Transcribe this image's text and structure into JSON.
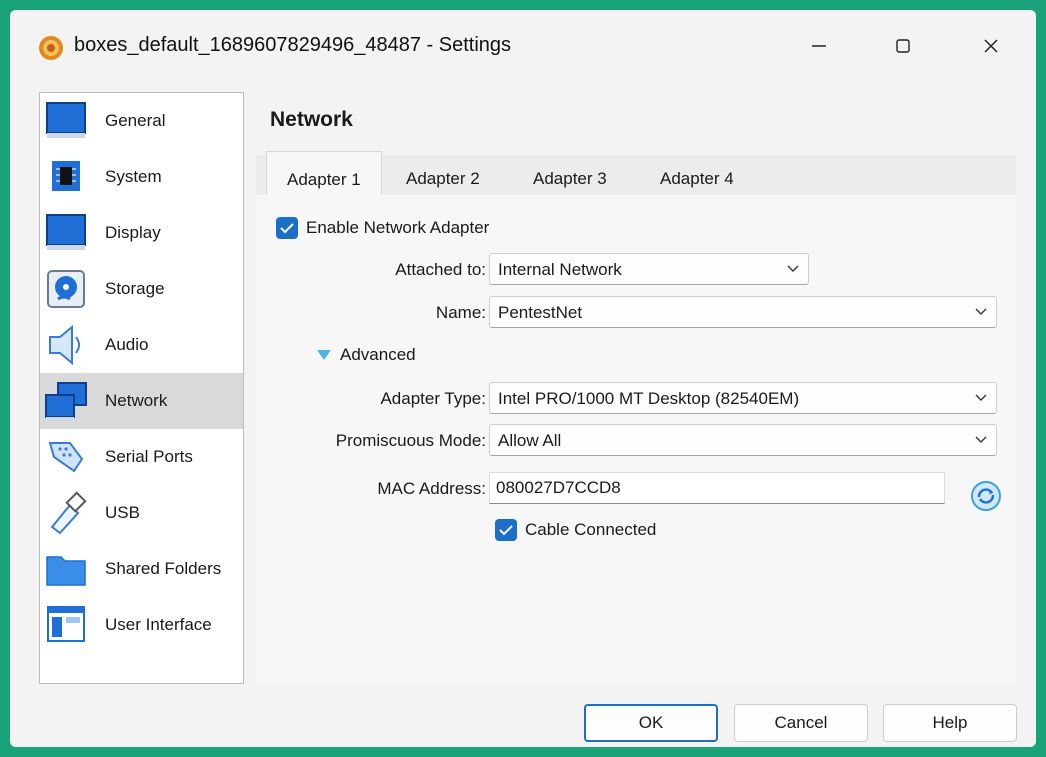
{
  "window": {
    "title": "boxes_default_1689607829496_48487 - Settings",
    "icons": {
      "app": "virtualbox-gear-icon",
      "minimize": "minimize-icon",
      "maximize": "maximize-icon",
      "close": "close-icon"
    }
  },
  "sidebar": {
    "items": [
      {
        "label": "General",
        "icon": "general-icon"
      },
      {
        "label": "System",
        "icon": "system-chip-icon"
      },
      {
        "label": "Display",
        "icon": "display-monitor-icon"
      },
      {
        "label": "Storage",
        "icon": "storage-disk-icon"
      },
      {
        "label": "Audio",
        "icon": "audio-speaker-icon"
      },
      {
        "label": "Network",
        "icon": "network-icon",
        "selected": true
      },
      {
        "label": "Serial Ports",
        "icon": "serial-port-icon"
      },
      {
        "label": "USB",
        "icon": "usb-icon"
      },
      {
        "label": "Shared Folders",
        "icon": "folder-icon"
      },
      {
        "label": "User Interface",
        "icon": "user-interface-icon"
      }
    ]
  },
  "panel": {
    "title": "Network",
    "tabs": [
      {
        "label": "Adapter 1",
        "active": true
      },
      {
        "label": "Adapter 2"
      },
      {
        "label": "Adapter 3"
      },
      {
        "label": "Adapter 4"
      }
    ],
    "enable_adapter": {
      "label": "Enable Network Adapter",
      "checked": true
    },
    "attached_to": {
      "label": "Attached to:",
      "value": "Internal Network"
    },
    "name": {
      "label": "Name:",
      "value": "PentestNet"
    },
    "advanced": {
      "label": "Advanced",
      "expanded": true
    },
    "adapter_type": {
      "label": "Adapter Type:",
      "value": "Intel PRO/1000 MT Desktop (82540EM)"
    },
    "promiscuous_mode": {
      "label": "Promiscuous Mode:",
      "value": "Allow All"
    },
    "mac_address": {
      "label": "MAC Address:",
      "value": "080027D7CCD8"
    },
    "cable_connected": {
      "label": "Cable Connected",
      "checked": true
    }
  },
  "buttons": {
    "ok": "OK",
    "cancel": "Cancel",
    "help": "Help"
  },
  "colors": {
    "accent": "#1b6fc7",
    "frame": "#1aa37a",
    "selected_row": "#d9d9d9"
  }
}
